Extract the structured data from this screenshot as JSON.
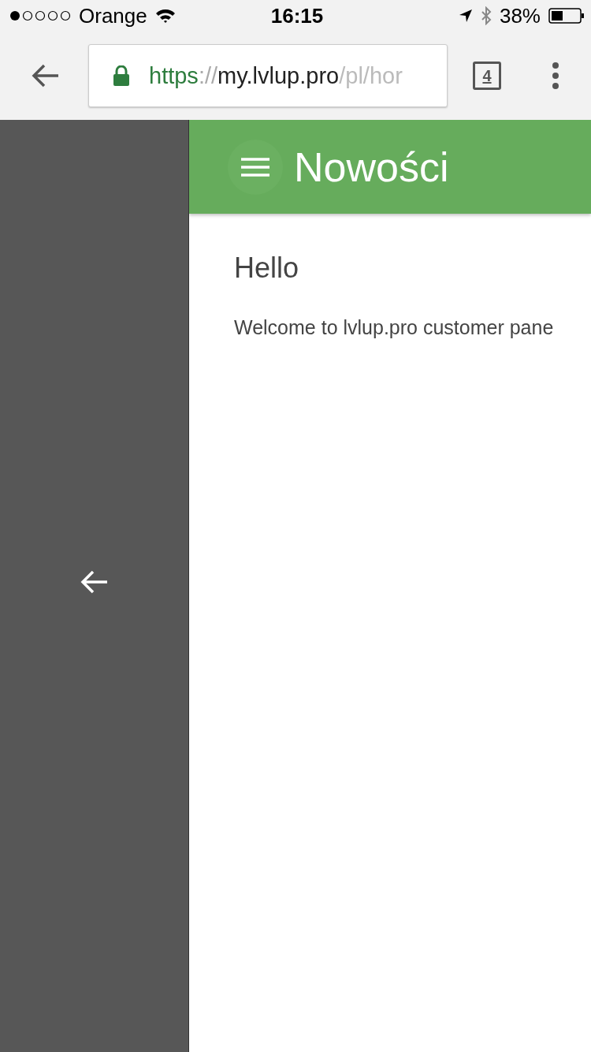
{
  "status_bar": {
    "carrier": "Orange",
    "time": "16:15",
    "battery": "38%"
  },
  "browser": {
    "url": [
      {
        "kind": "scheme",
        "text": "https"
      },
      {
        "kind": "separator",
        "text": "://"
      },
      {
        "kind": "host",
        "text": "my.lvlup.pro"
      },
      {
        "kind": "path",
        "text": "/pl/hor"
      }
    ],
    "tab_count": "4"
  },
  "app_bar": {
    "title": "Nowości"
  },
  "content": {
    "heading": "Hello",
    "text": "Welcome to lvlup.pro customer pane"
  }
}
